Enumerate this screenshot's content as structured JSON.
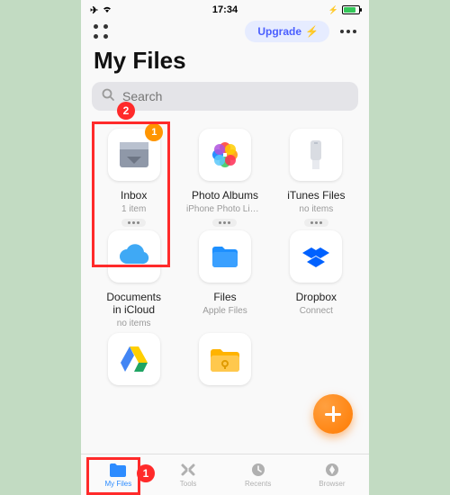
{
  "statusbar": {
    "time": "17:34"
  },
  "header": {
    "upgrade_label": "Upgrade"
  },
  "title": "My Files",
  "search": {
    "placeholder": "Search"
  },
  "grid": [
    {
      "name": "Inbox",
      "sub": "1 item",
      "kind": "inbox",
      "badge": "1",
      "more": true
    },
    {
      "name": "Photo Albums",
      "sub": "iPhone Photo Libra...",
      "kind": "photos",
      "more": true
    },
    {
      "name": "iTunes Files",
      "sub": "no items",
      "kind": "itunes",
      "more": true
    },
    {
      "name": "Documents in iCloud",
      "sub": "no items",
      "kind": "icloud",
      "more": false
    },
    {
      "name": "Files",
      "sub": "Apple Files",
      "kind": "files",
      "more": false
    },
    {
      "name": "Dropbox",
      "sub": "Connect",
      "kind": "dropbox",
      "more": false
    },
    {
      "name": "",
      "sub": "",
      "kind": "gdrive",
      "more": false
    },
    {
      "name": "",
      "sub": "",
      "kind": "folder",
      "more": false
    }
  ],
  "tabs": [
    {
      "label": "My Files",
      "active": true
    },
    {
      "label": "Tools",
      "active": false
    },
    {
      "label": "Recents",
      "active": false
    },
    {
      "label": "Browser",
      "active": false
    }
  ],
  "annotations": {
    "search_badge": "2",
    "inbox_badge": "1",
    "tab_badge": "1"
  }
}
